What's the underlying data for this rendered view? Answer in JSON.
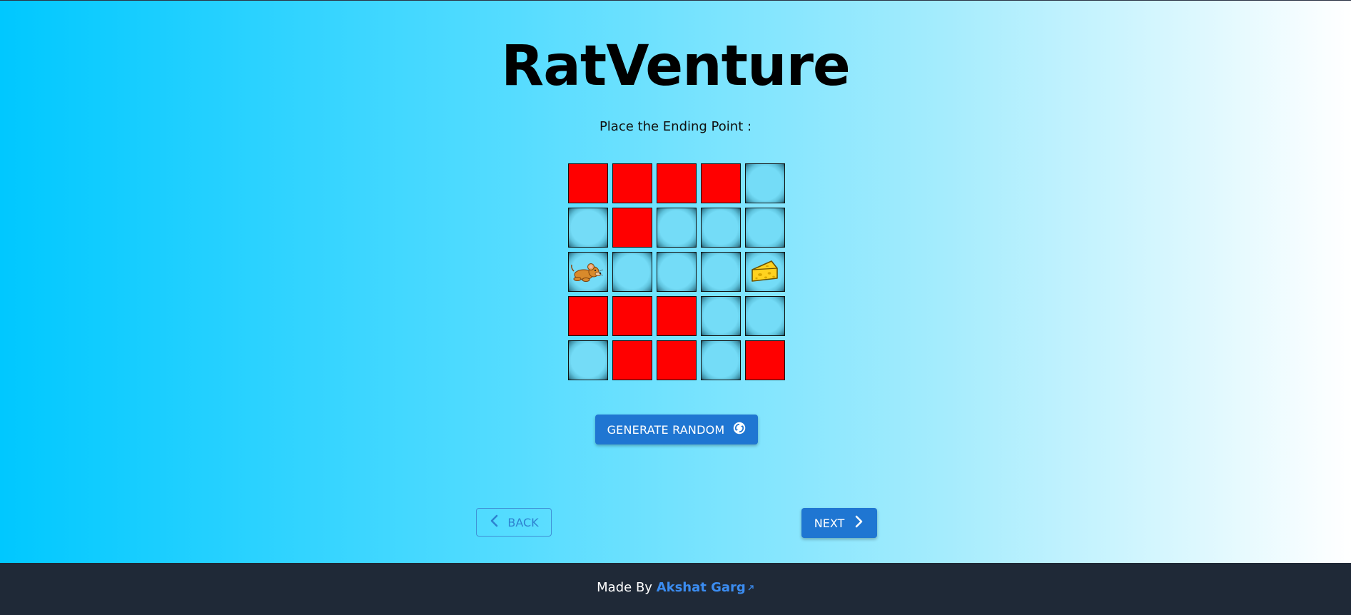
{
  "app": {
    "title": "RatVenture",
    "instruction": "Place the Ending Point :"
  },
  "grid": {
    "rows": 5,
    "cols": 5,
    "cells": [
      [
        "wall",
        "wall",
        "wall",
        "wall",
        "open"
      ],
      [
        "open",
        "wall",
        "open",
        "open",
        "open"
      ],
      [
        "rat",
        "open",
        "open",
        "open",
        "cheese"
      ],
      [
        "wall",
        "wall",
        "wall",
        "open",
        "open"
      ],
      [
        "open",
        "wall",
        "wall",
        "open",
        "wall"
      ]
    ]
  },
  "buttons": {
    "generate_label": "GENERATE RANDOM",
    "back_label": "BACK",
    "next_label": "NEXT"
  },
  "footer": {
    "prefix": "Made By",
    "author": "Akshat Garg"
  },
  "icons": {
    "generate": "refresh-icon",
    "back": "chevron-left-icon",
    "next": "chevron-right-icon",
    "start": "rat-icon",
    "end": "cheese-icon",
    "link": "external-link-icon"
  },
  "colors": {
    "wall": "#ff0000",
    "open": "#74dcf7",
    "button": "#1f76d2",
    "footer": "#1f2937",
    "link": "#3b8cf0"
  }
}
